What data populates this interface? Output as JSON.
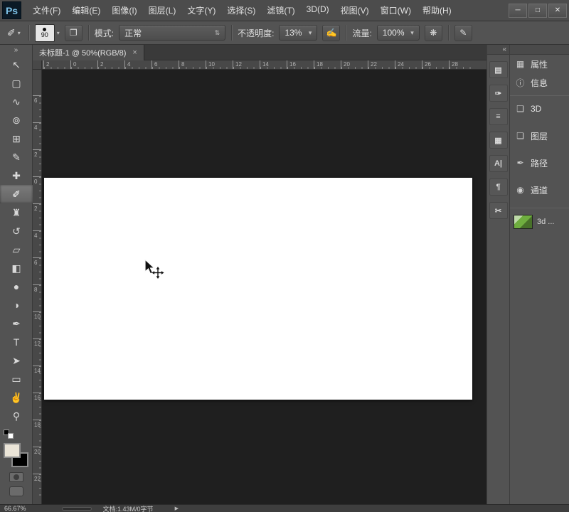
{
  "titlebar": {
    "logo": "Ps",
    "menus": [
      "文件(F)",
      "编辑(E)",
      "图像(I)",
      "图层(L)",
      "文字(Y)",
      "选择(S)",
      "滤镜(T)",
      "3D(D)",
      "视图(V)",
      "窗口(W)",
      "帮助(H)"
    ],
    "window_controls": {
      "minimize": "─",
      "maximize": "□",
      "close": "✕"
    }
  },
  "options_bar": {
    "tool_glyph": "✐",
    "dropdown_arrow": "▾",
    "spinner_arrow": "⇅",
    "brush_size": "90",
    "panel_toggle_glyph": "❐",
    "mode_label": "模式:",
    "mode_value": "正常",
    "opacity_label": "不透明度:",
    "opacity_value": "13%",
    "opacity_pressure_glyph": "✍",
    "flow_label": "流量:",
    "flow_value": "100%",
    "airbrush_glyph": "❋",
    "pen_pressure_glyph": "✎"
  },
  "tabbar": {
    "tabs": [
      {
        "title": "未标题-1 @ 50%(RGB/8)",
        "close": "×"
      }
    ]
  },
  "rulers": {
    "horizontal": [
      "2",
      "0",
      "2",
      "4",
      "6",
      "8",
      "10",
      "12",
      "14",
      "16",
      "18",
      "20",
      "22",
      "24",
      "26",
      "28"
    ],
    "vertical": [
      "6",
      "4",
      "2",
      "0",
      "2",
      "4",
      "6",
      "8",
      "10",
      "12",
      "14",
      "16",
      "18",
      "20",
      "22"
    ]
  },
  "toolbar": {
    "collapse": "»",
    "tools": [
      {
        "name": "move-tool",
        "glyph": "↖"
      },
      {
        "name": "marquee-tool",
        "glyph": "▢"
      },
      {
        "name": "lasso-tool",
        "glyph": "∿"
      },
      {
        "name": "quick-selection-tool",
        "glyph": "⊚"
      },
      {
        "name": "crop-tool",
        "glyph": "⊞"
      },
      {
        "name": "eyedropper-tool",
        "glyph": "✎"
      },
      {
        "name": "healing-brush-tool",
        "glyph": "✚"
      },
      {
        "name": "brush-tool",
        "glyph": "✐",
        "selected": true
      },
      {
        "name": "clone-stamp-tool",
        "glyph": "♜"
      },
      {
        "name": "history-brush-tool",
        "glyph": "↺"
      },
      {
        "name": "eraser-tool",
        "glyph": "▱"
      },
      {
        "name": "gradient-tool",
        "glyph": "◧"
      },
      {
        "name": "blur-tool",
        "glyph": "●"
      },
      {
        "name": "dodge-tool",
        "glyph": "◑"
      },
      {
        "name": "pen-tool",
        "glyph": "✒"
      },
      {
        "name": "type-tool",
        "glyph": "T"
      },
      {
        "name": "path-selection-tool",
        "glyph": "➤"
      },
      {
        "name": "shape-tool",
        "glyph": "▭"
      },
      {
        "name": "hand-tool",
        "glyph": "✌"
      },
      {
        "name": "zoom-tool",
        "glyph": "⚲"
      }
    ]
  },
  "swatches": {
    "foreground": "#ebe5d8",
    "background": "#000000"
  },
  "panel_strip": {
    "collapse": "«",
    "icons": [
      {
        "name": "adjustments-panel-icon",
        "glyph": "▤"
      },
      {
        "name": "styles-panel-icon",
        "glyph": "✑"
      },
      {
        "name": "brush-panel-icon",
        "glyph": "≡"
      },
      {
        "name": "clone-source-panel-icon",
        "glyph": "▦"
      },
      {
        "name": "character-panel-icon",
        "glyph": "A|"
      },
      {
        "name": "paragraph-panel-icon",
        "glyph": "¶"
      },
      {
        "name": "tool-presets-panel-icon",
        "glyph": "✂"
      }
    ]
  },
  "dock": {
    "group1": [
      {
        "name": "properties-panel-button",
        "icon": "▦",
        "label": "属性"
      },
      {
        "name": "info-panel-button",
        "icon": "ⓘ",
        "label": "信息"
      }
    ],
    "group2": [
      {
        "name": "3d-panel-button",
        "icon": "❑",
        "label": "3D"
      },
      {
        "name": "layers-panel-button",
        "icon": "❏",
        "label": "图层"
      },
      {
        "name": "paths-panel-button",
        "icon": "✒",
        "label": "路径"
      },
      {
        "name": "channels-panel-button",
        "icon": "◉",
        "label": "通道"
      }
    ],
    "layer_item": {
      "label": "3d ...",
      "thumb_color": "#6fae3f"
    }
  },
  "canvas": {
    "color": "#ffffff"
  },
  "statusbar": {
    "zoom": "66.67%",
    "doc_label": "文档:1.43M/0字节",
    "expand": "▶"
  }
}
